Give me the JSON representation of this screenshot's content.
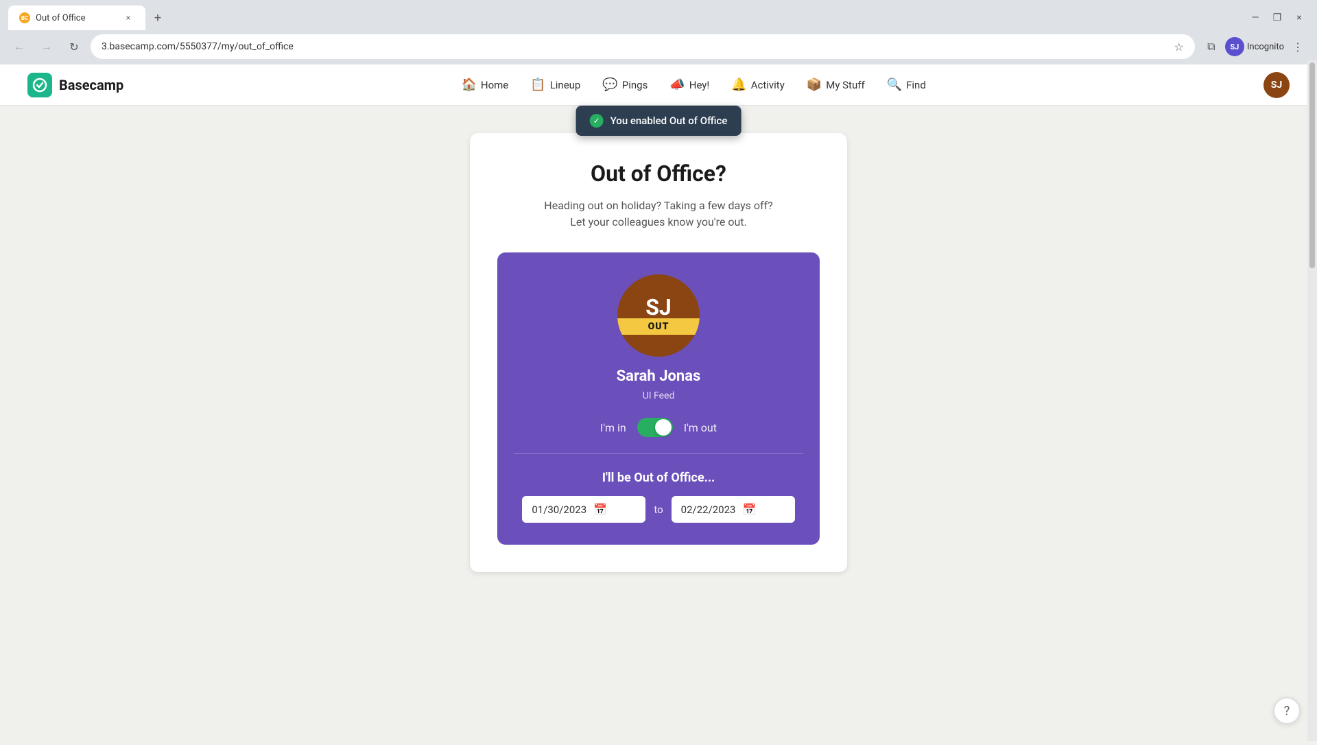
{
  "browser": {
    "tab": {
      "favicon": "BC",
      "title": "Out of Office",
      "close_icon": "×"
    },
    "new_tab_icon": "+",
    "window_controls": {
      "minimize": "—",
      "maximize": "❐",
      "close": "×"
    },
    "toolbar": {
      "back_icon": "←",
      "forward_icon": "→",
      "refresh_icon": "↻",
      "url": "3.basecamp.com/5550377/my/out_of_office",
      "star_icon": "☆",
      "extensions_icon": "⧉",
      "profile_label": "Incognito",
      "profile_initials": "SJ",
      "menu_icon": "⋮"
    }
  },
  "header": {
    "logo_text": "Basecamp",
    "nav": [
      {
        "icon": "🏠",
        "label": "Home"
      },
      {
        "icon": "📋",
        "label": "Lineup"
      },
      {
        "icon": "💬",
        "label": "Pings"
      },
      {
        "icon": "📣",
        "label": "Hey!"
      },
      {
        "icon": "🔔",
        "label": "Activity"
      },
      {
        "icon": "📦",
        "label": "My Stuff"
      },
      {
        "icon": "🔍",
        "label": "Find"
      }
    ],
    "user_initials": "SJ"
  },
  "toast": {
    "check_icon": "✓",
    "message": "You enabled Out of Office"
  },
  "page": {
    "title": "Out of Office?",
    "subtitle_line1": "Heading out on holiday? Taking a few days off?",
    "subtitle_line2": "Let your colleagues know you're out."
  },
  "profile_card": {
    "initials": "SJ",
    "out_badge": "OUT",
    "name": "Sarah Jonas",
    "company": "UI Feed",
    "toggle": {
      "label_left": "I'm in",
      "label_right": "I'm out"
    },
    "date_section": {
      "title": "I'll be Out of Office...",
      "from_date": "01/30/2023",
      "to_label": "to",
      "to_date": "02/22/2023",
      "calendar_icon": "📅"
    }
  },
  "help_icon": "?"
}
